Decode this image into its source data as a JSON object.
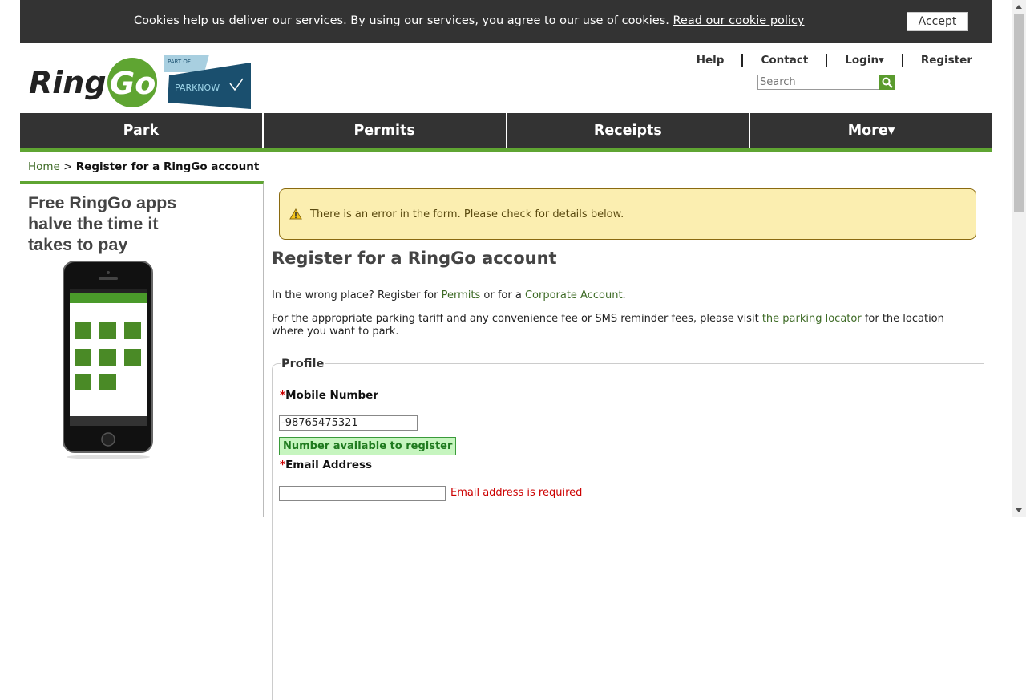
{
  "cookie_bar": {
    "message": "Cookies help us deliver our services. By using our services, you agree to our use of cookies.",
    "policy_link": "Read our cookie policy",
    "accept_label": "Accept"
  },
  "header": {
    "logo_text": "RingGo",
    "partner_part_of": "PART OF",
    "partner_name": "PARKNOW",
    "links": {
      "help": "Help",
      "contact": "Contact",
      "login": "Login▾",
      "register": "Register"
    },
    "search_placeholder": "Search"
  },
  "nav": {
    "park": "Park",
    "permits": "Permits",
    "receipts": "Receipts",
    "more": "More▾"
  },
  "breadcrumb": {
    "home": "Home",
    "separator": ">",
    "current": "Register for a RingGo account"
  },
  "sidebar": {
    "promo_line1": "Free RingGo apps",
    "promo_line2": "halve the time it",
    "promo_line3": "takes to pay"
  },
  "main": {
    "error_message": "There is an error in the form. Please check for details below.",
    "title": "Register for a RingGo account",
    "wrong_place_prefix": "In the wrong place? Register for ",
    "permits_link": "Permits",
    "wrong_place_mid": " or for a ",
    "corporate_link": "Corporate Account",
    "wrong_place_suffix": ".",
    "tariff_prefix": "For the appropriate parking tariff and any convenience fee or SMS reminder fees, please visit ",
    "locator_link": "the parking locator",
    "tariff_suffix": " for the location where you want to park.",
    "profile_legend": "Profile",
    "mobile_label": "Mobile Number",
    "mobile_value": "-98765475321",
    "mobile_status": "Number available to register",
    "email_label": "Email Address",
    "email_value": "",
    "email_error": "Email address is required",
    "required_marker": "*"
  },
  "colors": {
    "brand_green": "#5fa532",
    "dark_bar": "#333333",
    "error_bg": "#fbeeb0",
    "error_red": "#cc0000"
  }
}
